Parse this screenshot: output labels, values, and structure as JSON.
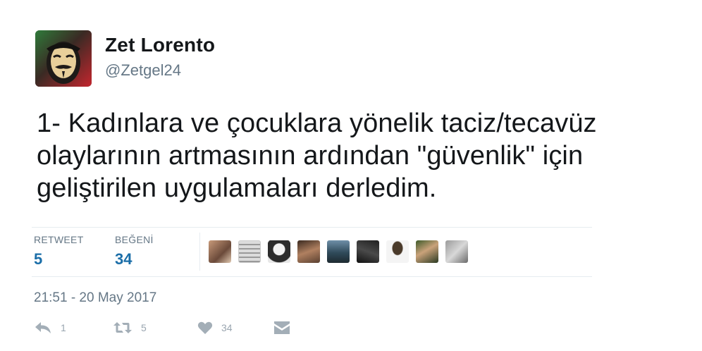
{
  "author": {
    "name": "Zet Lorento",
    "handle": "@Zetgel24"
  },
  "tweet": {
    "lines": [
      "1- Kadınlara ve çocuklara yönelik taciz/tecavüz",
      "olaylarının artmasının ardından \"güvenlik\" için",
      "geliştirilen uygulamaları derledim."
    ]
  },
  "stats": {
    "retweets_label": "RETWEET",
    "retweets_value": "5",
    "likes_label": "BEĞENİ",
    "likes_value": "34"
  },
  "likers_count_shown": 9,
  "timestamp": "21:51 - 20 May 2017",
  "actions": {
    "reply_count": "1",
    "retweet_count": "5",
    "like_count": "34"
  },
  "colors": {
    "name": "#14171a",
    "secondary": "#657786",
    "stat_value": "#1b6ea8",
    "action_icon": "#a3aeb7"
  }
}
